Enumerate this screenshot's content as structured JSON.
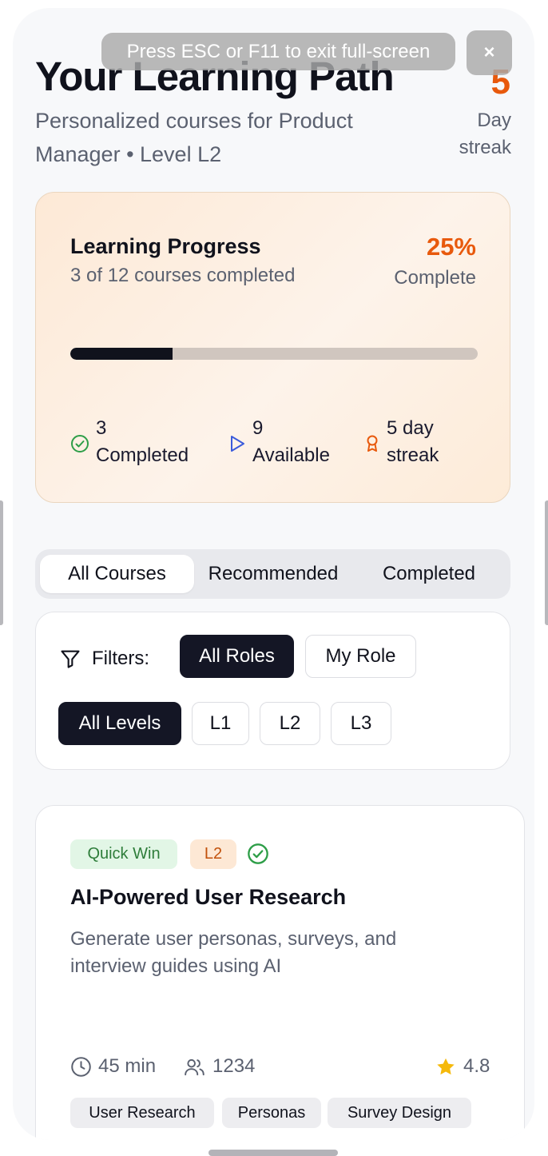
{
  "header": {
    "title": "Your Learning Path",
    "subtitle": "Personalized courses for Product Manager • Level L2",
    "streak_value": "5",
    "streak_label": "Day streak"
  },
  "progress": {
    "title": "Learning Progress",
    "subtitle": "3 of 12 courses completed",
    "percent_label": "25%",
    "complete_label": "Complete",
    "fraction": 0.25,
    "stats": [
      {
        "value": "3",
        "label": "Completed",
        "icon": "check-circle-icon"
      },
      {
        "value": "9",
        "label": "Available",
        "icon": "play-icon"
      },
      {
        "value": "5 day",
        "label": "streak",
        "icon": "award-icon"
      }
    ]
  },
  "tabs": [
    "All Courses",
    "Recommended",
    "Completed"
  ],
  "filters": {
    "label": "Filters:",
    "roles": [
      "All Roles",
      "My Role"
    ],
    "levels": [
      "All Levels",
      "L1",
      "L2",
      "L3"
    ]
  },
  "course": {
    "badge_type": "Quick Win",
    "badge_level": "L2",
    "title": "AI-Powered User Research",
    "description": "Generate user personas, surveys, and interview guides using AI",
    "duration": "45 min",
    "learners": "1234",
    "rating": "4.8",
    "tags": [
      "User Research",
      "Personas",
      "Survey Design"
    ]
  },
  "overlay": {
    "fullscreen_message": "Press ESC or F11 to exit full-screen",
    "close_label": "×"
  },
  "colors": {
    "accent": "#e8590c",
    "dark": "#10121c",
    "success": "#2e9e48",
    "info": "#3b5bdb"
  }
}
